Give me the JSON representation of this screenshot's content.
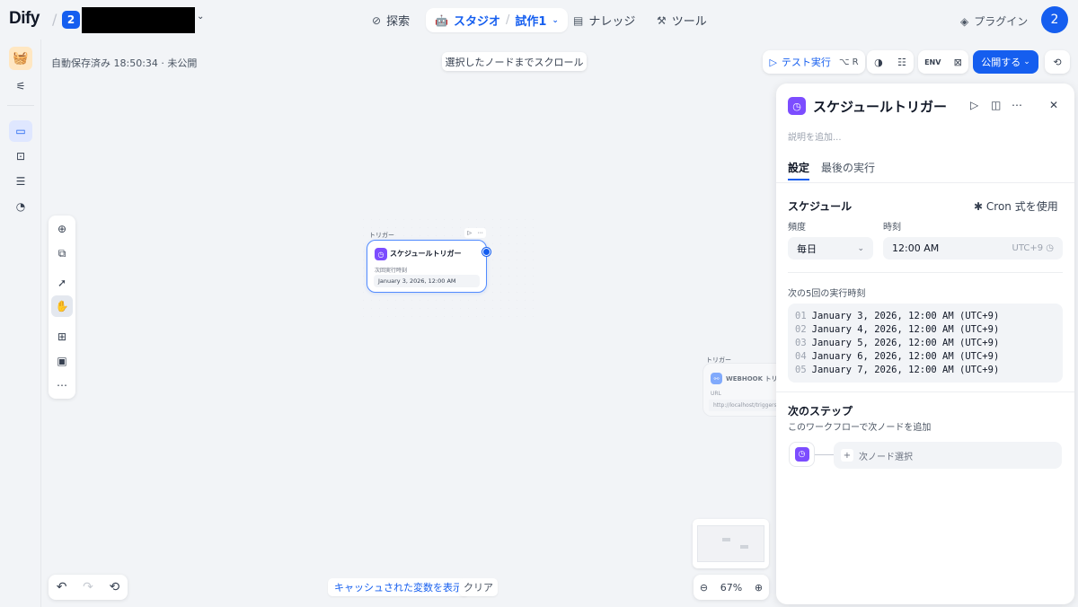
{
  "header": {
    "logo": "Dify",
    "workspace_badge": "2",
    "nav": {
      "explore": "探索",
      "studio": "スタジオ",
      "app_name": "試作1",
      "knowledge": "ナレッジ",
      "tools": "ツール"
    },
    "plugin": "プラグイン",
    "avatar": "2"
  },
  "canvas": {
    "autosave": "自動保存済み 18:50:34 · 未公開",
    "scroll_to_node": "選択したノードまでスクロール",
    "show_cached": "キャッシュされた変数を表示",
    "clear": "クリア",
    "zoom": "67%",
    "node1": {
      "label": "トリガー",
      "title": "スケジュールトリガー",
      "sub": "次回実行時刻",
      "value": "January 3, 2026, 12:00 AM"
    },
    "node2": {
      "label": "トリガー",
      "title": "WEBHOOK トリガー",
      "sub": "URL",
      "value": "http://localhost/triggers/webhook"
    }
  },
  "toolbar": {
    "test_run": "テスト実行",
    "shortcut": "⌥ R",
    "publish": "公開する"
  },
  "panel": {
    "title": "スケジュールトリガー",
    "desc_placeholder": "説明を追加...",
    "tabs": [
      "設定",
      "最後の実行"
    ],
    "schedule_title": "スケジュール",
    "cron": "Cron 式を使用",
    "freq_label": "頻度",
    "freq_value": "毎日",
    "time_label": "時刻",
    "time_value": "12:00 AM",
    "tz": "UTC+9",
    "runs_title": "次の5回の実行時刻",
    "runs": [
      {
        "n": "01",
        "t": "January 3, 2026, 12:00 AM (UTC+9)"
      },
      {
        "n": "02",
        "t": "January 4, 2026, 12:00 AM (UTC+9)"
      },
      {
        "n": "03",
        "t": "January 5, 2026, 12:00 AM (UTC+9)"
      },
      {
        "n": "04",
        "t": "January 6, 2026, 12:00 AM (UTC+9)"
      },
      {
        "n": "05",
        "t": "January 7, 2026, 12:00 AM (UTC+9)"
      }
    ],
    "next_step_title": "次のステップ",
    "next_step_sub": "このワークフローで次ノードを追加",
    "next_node_select": "次ノード選択"
  },
  "colors": {
    "accent": "#155eef",
    "trigger_icon": "#7c4dff"
  }
}
